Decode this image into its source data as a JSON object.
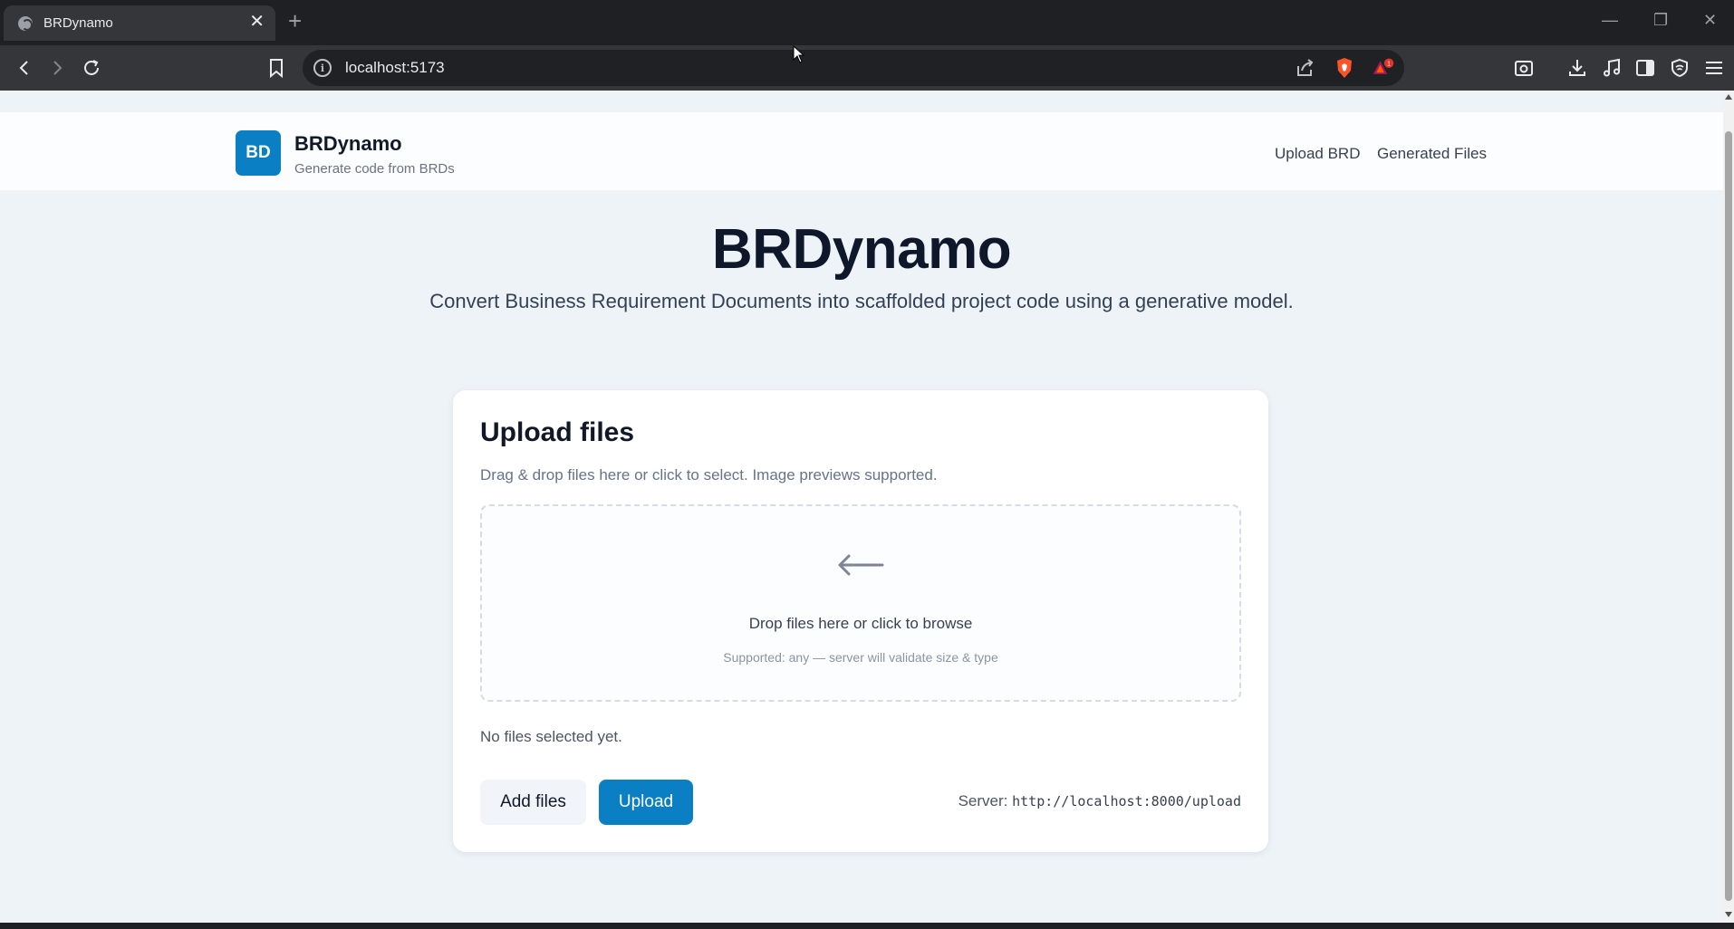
{
  "browser": {
    "tab_title": "BRDynamo",
    "tab_close": "✕",
    "new_tab": "+",
    "url": "localhost:5173",
    "window_controls": {
      "minimize": "—",
      "restore": "❐",
      "close": "✕"
    },
    "notification_count": "1",
    "icons": [
      "back-icon",
      "forward-icon",
      "reload-icon",
      "bookmark-icon",
      "site-info-icon",
      "share-icon",
      "brave-shields-icon",
      "brave-rewards-icon",
      "screenshot-icon",
      "downloads-icon",
      "media-icon",
      "sidebar-icon",
      "vpn-icon",
      "menu-icon"
    ]
  },
  "app": {
    "logo_text": "BD",
    "brand_name": "BRDynamo",
    "brand_tagline": "Generate code from BRDs",
    "nav": [
      "Upload BRD",
      "Generated Files"
    ]
  },
  "hero": {
    "title": "BRDynamo",
    "subtitle": "Convert Business Requirement Documents into scaffolded project code using a generative model."
  },
  "upload_card": {
    "title": "Upload files",
    "description": "Drag & drop files here or click to select. Image previews supported.",
    "dropzone_main": "Drop files here or click to browse",
    "dropzone_sub": "Supported: any — server will validate size & type",
    "empty_message": "No files selected yet.",
    "add_button": "Add files",
    "upload_button": "Upload",
    "server_label": "Server:",
    "server_url": "http://localhost:8000/upload"
  },
  "colors": {
    "accent": "#0a7fc4",
    "page_bg": "#eef3f8",
    "chrome_dark": "#1f2023",
    "chrome_toolbar": "#35363a"
  }
}
